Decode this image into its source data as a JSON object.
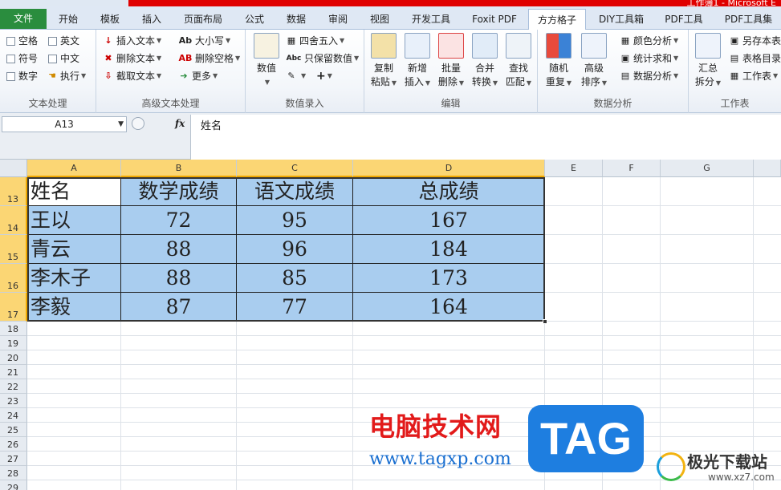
{
  "window": {
    "title_fragment": "工作簿1 - Microsoft E"
  },
  "tabs": [
    "文件",
    "开始",
    "模板",
    "插入",
    "页面布局",
    "公式",
    "数据",
    "审阅",
    "视图",
    "开发工具",
    "Foxit PDF",
    "方方格子",
    "DIY工具箱",
    "PDF工具",
    "PDF工具集"
  ],
  "ribbon": {
    "text_proc": {
      "label": "文本处理",
      "items": [
        "空格",
        "英文",
        "符号",
        "中文",
        "数字",
        "执行"
      ]
    },
    "adv_text": {
      "label": "高级文本处理",
      "items": [
        "插入文本",
        "大小写",
        "删除文本",
        "删除空格",
        "截取文本",
        "更多"
      ]
    },
    "num_input": {
      "label": "数值录入",
      "big": "数值",
      "items": [
        "四舍五入",
        "只保留数值",
        "+"
      ]
    },
    "edit": {
      "label": "编辑",
      "buttons": [
        {
          "l1": "复制",
          "l2": "粘贴"
        },
        {
          "l1": "新增",
          "l2": "插入"
        },
        {
          "l1": "批量",
          "l2": "删除"
        },
        {
          "l1": "合并",
          "l2": "转换"
        },
        {
          "l1": "查找",
          "l2": "匹配"
        }
      ]
    },
    "analysis": {
      "label": "数据分析",
      "buttons": [
        {
          "l1": "随机",
          "l2": "重复"
        },
        {
          "l1": "高级",
          "l2": "排序"
        }
      ],
      "items": [
        "颜色分析",
        "统计求和",
        "数据分析"
      ]
    },
    "sheet": {
      "label": "工作表",
      "big": {
        "l1": "汇总",
        "l2": "拆分"
      },
      "items": [
        "另存本表",
        "表格目录",
        "工作表"
      ]
    }
  },
  "formula_bar": {
    "name_box": "A13",
    "fx": "fx",
    "value": "姓名"
  },
  "columns": [
    "A",
    "B",
    "C",
    "D",
    "E",
    "F",
    "G"
  ],
  "rows": [
    "13",
    "14",
    "15",
    "16",
    "17",
    "18",
    "19",
    "20",
    "21",
    "22",
    "23",
    "24",
    "25",
    "26",
    "27",
    "28",
    "29"
  ],
  "table": {
    "header": [
      "姓名",
      "数学成绩",
      "语文成绩",
      "总成绩"
    ],
    "data": [
      [
        "王以",
        "72",
        "95",
        "167"
      ],
      [
        "青云",
        "88",
        "96",
        "184"
      ],
      [
        "李木子",
        "88",
        "85",
        "173"
      ],
      [
        "李毅",
        "87",
        "77",
        "164"
      ]
    ]
  },
  "watermark": {
    "cn": "电脑技术网",
    "url": "www.tagxp.com",
    "tag": "TAG",
    "site_cn": "极光下载站",
    "site_url": "www.xz7.com"
  }
}
